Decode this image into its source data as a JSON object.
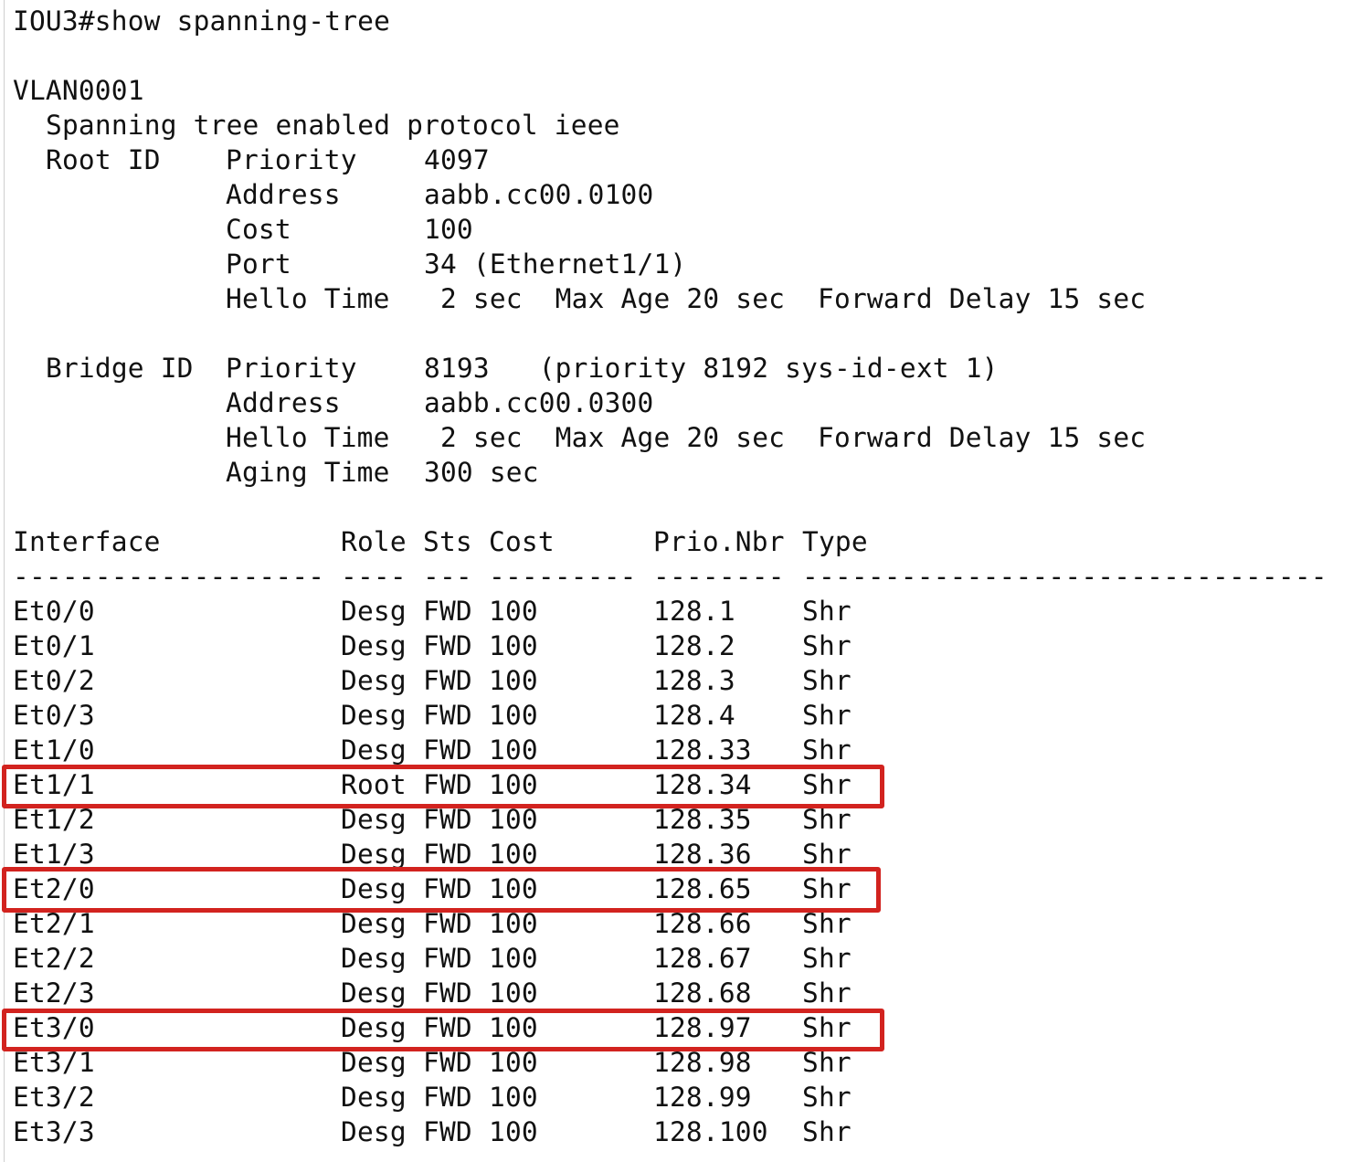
{
  "terminal": {
    "prompt_line": "IOU3#show spanning-tree",
    "vlan": "VLAN0001",
    "protocol_line": "Spanning tree enabled protocol ieee",
    "root_id": {
      "label": "Root ID",
      "priority_label": "Priority",
      "priority_value": "4097",
      "address_label": "Address",
      "address_value": "aabb.cc00.0100",
      "cost_label": "Cost",
      "cost_value": "100",
      "port_label": "Port",
      "port_value": "34 (Ethernet1/1)",
      "hello_label": "Hello Time",
      "hello_value": " 2 sec  Max Age 20 sec  Forward Delay 15 sec"
    },
    "bridge_id": {
      "label": "Bridge ID",
      "priority_label": "Priority",
      "priority_value": "8193   (priority 8192 sys-id-ext 1)",
      "address_label": "Address",
      "address_value": "aabb.cc00.0300",
      "hello_label": "Hello Time",
      "hello_value": " 2 sec  Max Age 20 sec  Forward Delay 15 sec",
      "aging_label": "Aging Time",
      "aging_value": "300 sec"
    },
    "table": {
      "headers": [
        "Interface",
        "Role",
        "Sts",
        "Cost",
        "Prio.Nbr",
        "Type"
      ],
      "separators": [
        "-------------------",
        "----",
        "---",
        "---------",
        "--------",
        "--------------------------------"
      ],
      "rows": [
        {
          "interface": "Et0/0",
          "role": "Desg",
          "sts": "FWD",
          "cost": "100",
          "prio": "128.1",
          "type": "Shr"
        },
        {
          "interface": "Et0/1",
          "role": "Desg",
          "sts": "FWD",
          "cost": "100",
          "prio": "128.2",
          "type": "Shr"
        },
        {
          "interface": "Et0/2",
          "role": "Desg",
          "sts": "FWD",
          "cost": "100",
          "prio": "128.3",
          "type": "Shr"
        },
        {
          "interface": "Et0/3",
          "role": "Desg",
          "sts": "FWD",
          "cost": "100",
          "prio": "128.4",
          "type": "Shr"
        },
        {
          "interface": "Et1/0",
          "role": "Desg",
          "sts": "FWD",
          "cost": "100",
          "prio": "128.33",
          "type": "Shr"
        },
        {
          "interface": "Et1/1",
          "role": "Root",
          "sts": "FWD",
          "cost": "100",
          "prio": "128.34",
          "type": "Shr"
        },
        {
          "interface": "Et1/2",
          "role": "Desg",
          "sts": "FWD",
          "cost": "100",
          "prio": "128.35",
          "type": "Shr"
        },
        {
          "interface": "Et1/3",
          "role": "Desg",
          "sts": "FWD",
          "cost": "100",
          "prio": "128.36",
          "type": "Shr"
        },
        {
          "interface": "Et2/0",
          "role": "Desg",
          "sts": "FWD",
          "cost": "100",
          "prio": "128.65",
          "type": "Shr"
        },
        {
          "interface": "Et2/1",
          "role": "Desg",
          "sts": "FWD",
          "cost": "100",
          "prio": "128.66",
          "type": "Shr"
        },
        {
          "interface": "Et2/2",
          "role": "Desg",
          "sts": "FWD",
          "cost": "100",
          "prio": "128.67",
          "type": "Shr"
        },
        {
          "interface": "Et2/3",
          "role": "Desg",
          "sts": "FWD",
          "cost": "100",
          "prio": "128.68",
          "type": "Shr"
        },
        {
          "interface": "Et3/0",
          "role": "Desg",
          "sts": "FWD",
          "cost": "100",
          "prio": "128.97",
          "type": "Shr"
        },
        {
          "interface": "Et3/1",
          "role": "Desg",
          "sts": "FWD",
          "cost": "100",
          "prio": "128.98",
          "type": "Shr"
        },
        {
          "interface": "Et3/2",
          "role": "Desg",
          "sts": "FWD",
          "cost": "100",
          "prio": "128.99",
          "type": "Shr"
        },
        {
          "interface": "Et3/3",
          "role": "Desg",
          "sts": "FWD",
          "cost": "100",
          "prio": "128.100",
          "type": "Shr"
        }
      ]
    },
    "highlighted_interfaces": [
      "Et1/1",
      "Et2/0",
      "Et3/0"
    ],
    "highlight_color": "#d2231f",
    "text_color": "#111111",
    "background_color": "#ffffff"
  }
}
